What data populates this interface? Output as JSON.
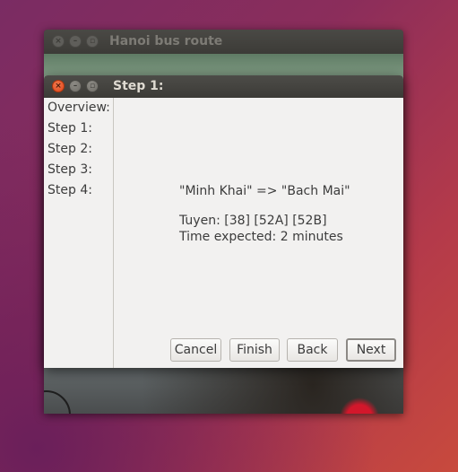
{
  "parent_window": {
    "title": "Hanoi bus route",
    "close_glyph": "×",
    "minimize_glyph": "–",
    "maximize_glyph": "▫"
  },
  "dialog": {
    "title": "Step 1:",
    "close_glyph": "×",
    "minimize_glyph": "–",
    "maximize_glyph": "▫",
    "sidebar": {
      "items": [
        {
          "label": "Overview:"
        },
        {
          "label": "Step 1:"
        },
        {
          "label": "Step 2:"
        },
        {
          "label": "Step 3:"
        },
        {
          "label": "Step 4:"
        }
      ]
    },
    "content": {
      "route": "\"Minh Khai\" => \"Bach Mai\"",
      "lines": "Tuyen: [38] [52A] [52B]",
      "time": "Time expected: 2 minutes"
    },
    "buttons": {
      "cancel": "Cancel",
      "finish": "Finish",
      "back": "Back",
      "next": "Next"
    }
  },
  "colors": {
    "accent_close": "#e0441a",
    "titlebar": "#3c3b37",
    "dialog_bg": "#f2f1f0"
  }
}
